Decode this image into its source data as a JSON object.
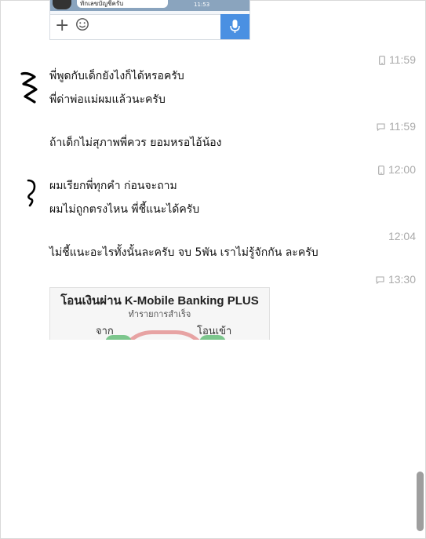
{
  "colors": {
    "accent_blue": "#4a90e2",
    "time_gray": "#aaaaaa",
    "text": "#111111"
  },
  "embed_top": {
    "bubble_text": "ทักเลขบัญชีครับ",
    "time": "11:53"
  },
  "entries": [
    {
      "time": "11:59",
      "status_icon": "phone-icon",
      "lines": [
        "พี่พูดกับเด็กยังไงก็ได้หรอครับ",
        "พี่ด่าพ่อแม่ผมแล้วนะครับ"
      ]
    },
    {
      "time": "11:59",
      "status_icon": "chat-icon",
      "lines": [
        "ถ้าเด็กไม่สุภาพพี่ควร ยอมหรอไอ้น้อง"
      ]
    },
    {
      "time": "12:00",
      "status_icon": "phone-icon",
      "lines": [
        "ผมเรียกพี่ทุกคำ ก่อนจะถาม",
        "ผมไม่ถูกตรงไหน พี่ชี้แนะได้ครับ"
      ]
    },
    {
      "time": "12:04",
      "status_icon": "",
      "lines": [
        "ไม่ชี้แนะอะไรทั้งนั้นละครับ จบ 5พัน เราไม่รู้จักกัน ละครับ"
      ]
    },
    {
      "time": "13:30",
      "status_icon": "chat-icon",
      "lines": []
    }
  ],
  "bank_image": {
    "title": "โอนเงินผ่าน K-Mobile Banking PLUS",
    "subtitle": "ทำรายการสำเร็จ",
    "from_label": "จาก",
    "to_label": "โอนเข้า"
  }
}
